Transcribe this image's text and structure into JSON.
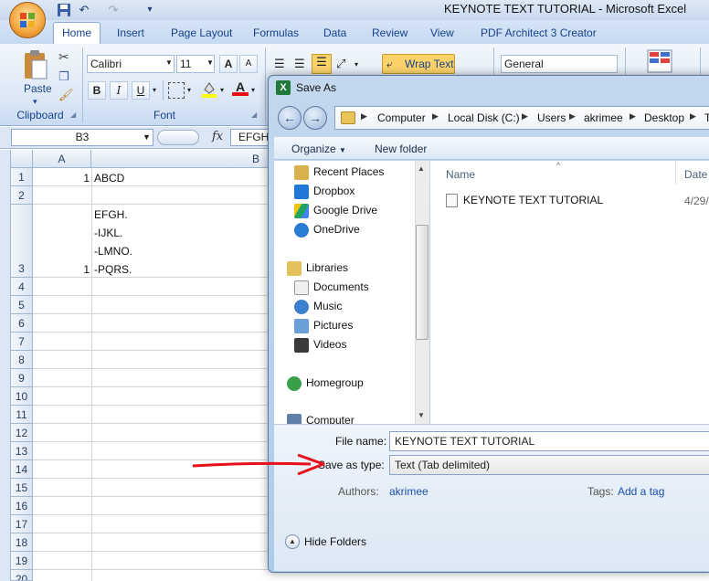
{
  "window": {
    "title": "KEYNOTE TEXT TUTORIAL - Microsoft Excel"
  },
  "ribbon": {
    "tabs": [
      "Home",
      "Insert",
      "Page Layout",
      "Formulas",
      "Data",
      "Review",
      "View",
      "PDF Architect 3 Creator"
    ],
    "clipboard": {
      "paste_label": "Paste",
      "group_label": "Clipboard"
    },
    "font": {
      "name": "Calibri",
      "size": "11",
      "group_label": "Font",
      "bold": "B",
      "italic": "I",
      "underline": "U",
      "grow": "A",
      "shrink": "A",
      "color_a": "A"
    },
    "alignment": {
      "wrap_text": "Wrap Text"
    },
    "number": {
      "format": "General"
    }
  },
  "formula_bar": {
    "name_box": "B3",
    "fx": "fx",
    "value": "EFGH"
  },
  "sheet": {
    "columns": [
      "A",
      "B"
    ],
    "row_numbers": [
      "1",
      "2",
      "3",
      "4",
      "5",
      "6",
      "7",
      "8",
      "9",
      "10",
      "11",
      "12",
      "13",
      "14",
      "15",
      "16",
      "17",
      "18",
      "19",
      "20"
    ],
    "cells": {
      "a1": "1",
      "b1": "ABCD",
      "a3": "1",
      "b3_lines": [
        "EFGH.",
        "-IJKL.",
        "-LMNO.",
        "-PQRS."
      ]
    }
  },
  "dialog": {
    "title": "Save As",
    "breadcrumbs": [
      "Computer",
      "Local Disk (C:)",
      "Users",
      "akrimee",
      "Desktop",
      "T"
    ],
    "commands": {
      "organize": "Organize",
      "new_folder": "New folder"
    },
    "nav": {
      "favorites": [
        "Recent Places",
        "Dropbox",
        "Google Drive",
        "OneDrive"
      ],
      "libraries_label": "Libraries",
      "libraries": [
        "Documents",
        "Music",
        "Pictures",
        "Videos"
      ],
      "homegroup": "Homegroup",
      "computer": "Computer"
    },
    "files": {
      "col_name": "Name",
      "col_date": "Date",
      "items": [
        {
          "name": "KEYNOTE TEXT TUTORIAL",
          "date": "4/29/"
        }
      ]
    },
    "form": {
      "file_name_label": "File name:",
      "file_name_value": "KEYNOTE TEXT TUTORIAL",
      "save_type_label": "Save as type:",
      "save_type_value": "Text (Tab delimited)",
      "authors_label": "Authors:",
      "authors_value": "akrimee",
      "tags_label": "Tags:",
      "tags_value": "Add a tag",
      "hide_folders": "Hide Folders"
    }
  },
  "colors": {
    "annotation_arrow": "#e8101a",
    "ribbon_text": "#15428b"
  }
}
